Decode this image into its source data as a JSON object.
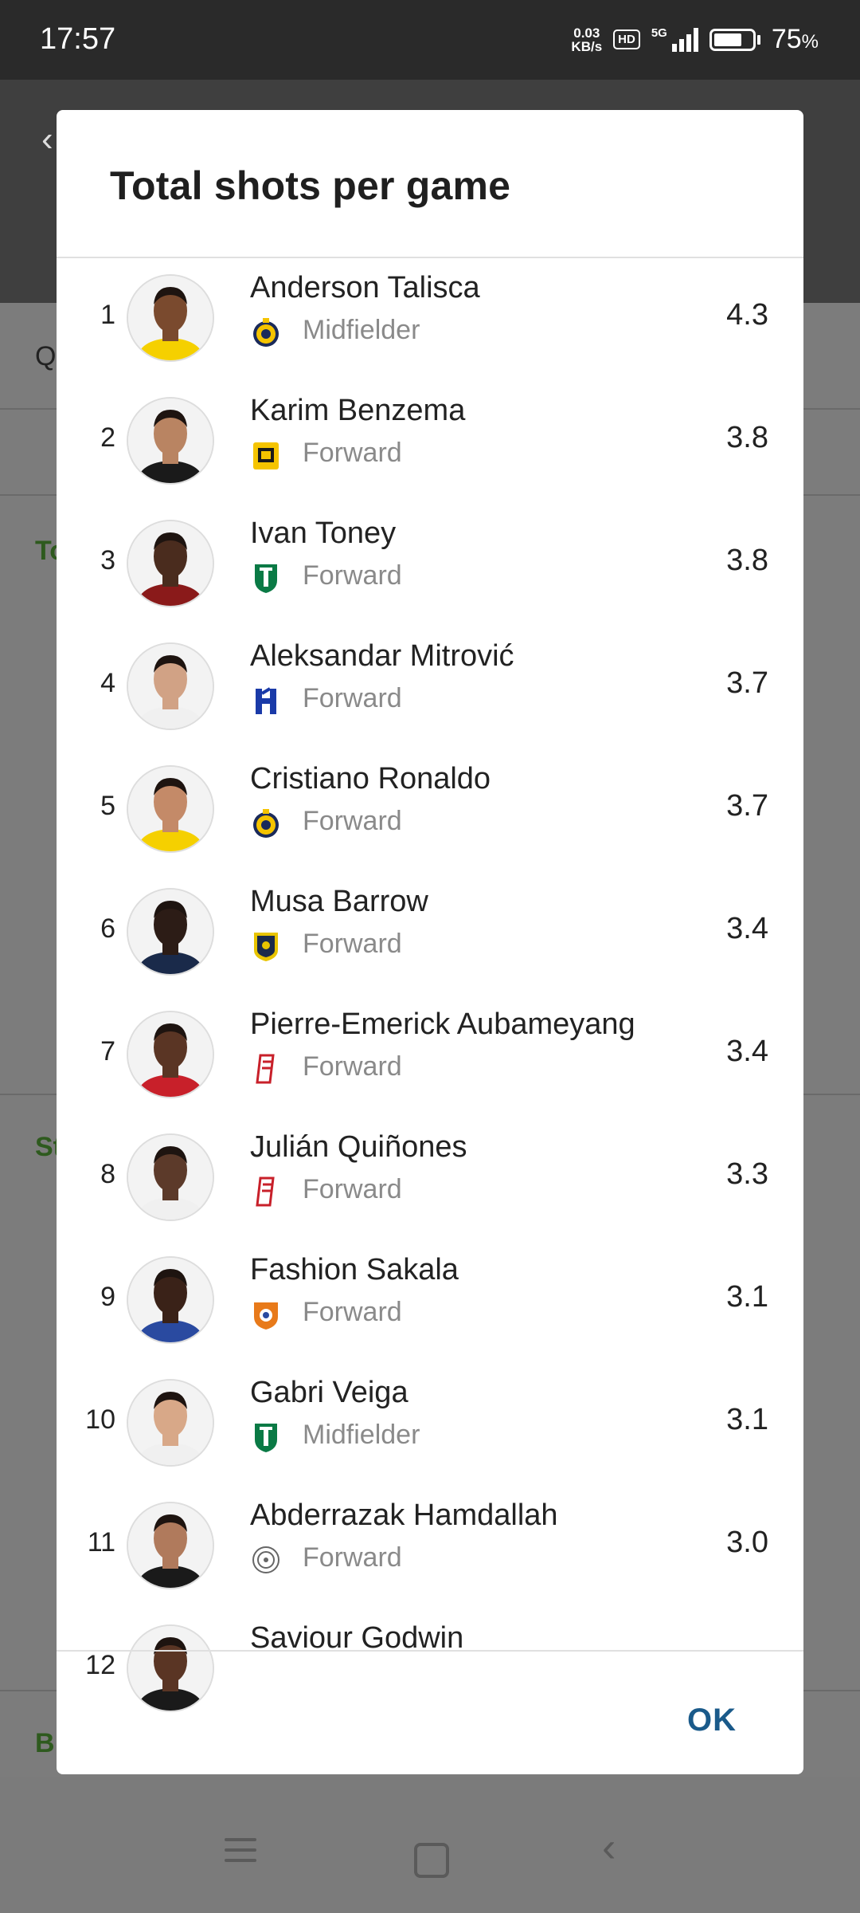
{
  "status_bar": {
    "time": "17:57",
    "net_speed_value": "0.03",
    "net_speed_unit": "KB/s",
    "hd_label": "HD",
    "network_label": "5G",
    "battery_level": 0.75,
    "battery_percent": "75",
    "battery_percent_sign": "%"
  },
  "background": {
    "fragment_q": "Q",
    "fragment_to": "To",
    "fragment_st": "St",
    "fragment_b": "B"
  },
  "dialog": {
    "title": "Total shots per game",
    "ok_label": "OK",
    "players": [
      {
        "rank": "1",
        "name": "Anderson Talisca",
        "position": "Midfielder",
        "value": "4.3",
        "team_icon": "al-nassr-crest-icon",
        "skin": "#7a4a2e",
        "shirt": "#f5d000"
      },
      {
        "rank": "2",
        "name": "Karim Benzema",
        "position": "Forward",
        "value": "3.8",
        "team_icon": "al-ittihad-crest-icon",
        "skin": "#b98462",
        "shirt": "#1a1a1a"
      },
      {
        "rank": "3",
        "name": "Ivan Toney",
        "position": "Forward",
        "value": "3.8",
        "team_icon": "al-ahli-crest-icon",
        "skin": "#4a2c1e",
        "shirt": "#8a1a1a"
      },
      {
        "rank": "4",
        "name": "Aleksandar Mitrović",
        "position": "Forward",
        "value": "3.7",
        "team_icon": "al-hilal-crest-icon",
        "skin": "#d1a285",
        "shirt": "#f0f0f0"
      },
      {
        "rank": "5",
        "name": "Cristiano Ronaldo",
        "position": "Forward",
        "value": "3.7",
        "team_icon": "al-nassr-crest-icon",
        "skin": "#c48a68",
        "shirt": "#f5d000"
      },
      {
        "rank": "6",
        "name": "Musa Barrow",
        "position": "Forward",
        "value": "3.4",
        "team_icon": "al-taawoun-crest-icon",
        "skin": "#2c1c16",
        "shirt": "#1a2a4a"
      },
      {
        "rank": "7",
        "name": "Pierre-Emerick Aubameyang",
        "position": "Forward",
        "value": "3.4",
        "team_icon": "al-qadsiah-crest-icon",
        "skin": "#5a3524",
        "shirt": "#c8202a"
      },
      {
        "rank": "8",
        "name": "Julián Quiñones",
        "position": "Forward",
        "value": "3.3",
        "team_icon": "al-qadsiah-crest-icon",
        "skin": "#5c3a2a",
        "shirt": "#f0f0f0"
      },
      {
        "rank": "9",
        "name": "Fashion Sakala",
        "position": "Forward",
        "value": "3.1",
        "team_icon": "al-fayha-crest-icon",
        "skin": "#3a2218",
        "shirt": "#2a4aa0"
      },
      {
        "rank": "10",
        "name": "Gabri Veiga",
        "position": "Midfielder",
        "value": "3.1",
        "team_icon": "al-ahli-crest-icon",
        "skin": "#d8a888",
        "shirt": "#f0f0f0"
      },
      {
        "rank": "11",
        "name": "Abderrazak Hamdallah",
        "position": "Forward",
        "value": "3.0",
        "team_icon": "al-shabab-crest-icon",
        "skin": "#b07a5c",
        "shirt": "#1a1a1a"
      },
      {
        "rank": "12",
        "name": "Saviour Godwin",
        "position": "",
        "value": "",
        "team_icon": "",
        "skin": "#5a3524",
        "shirt": "#1a1a1a"
      }
    ]
  }
}
